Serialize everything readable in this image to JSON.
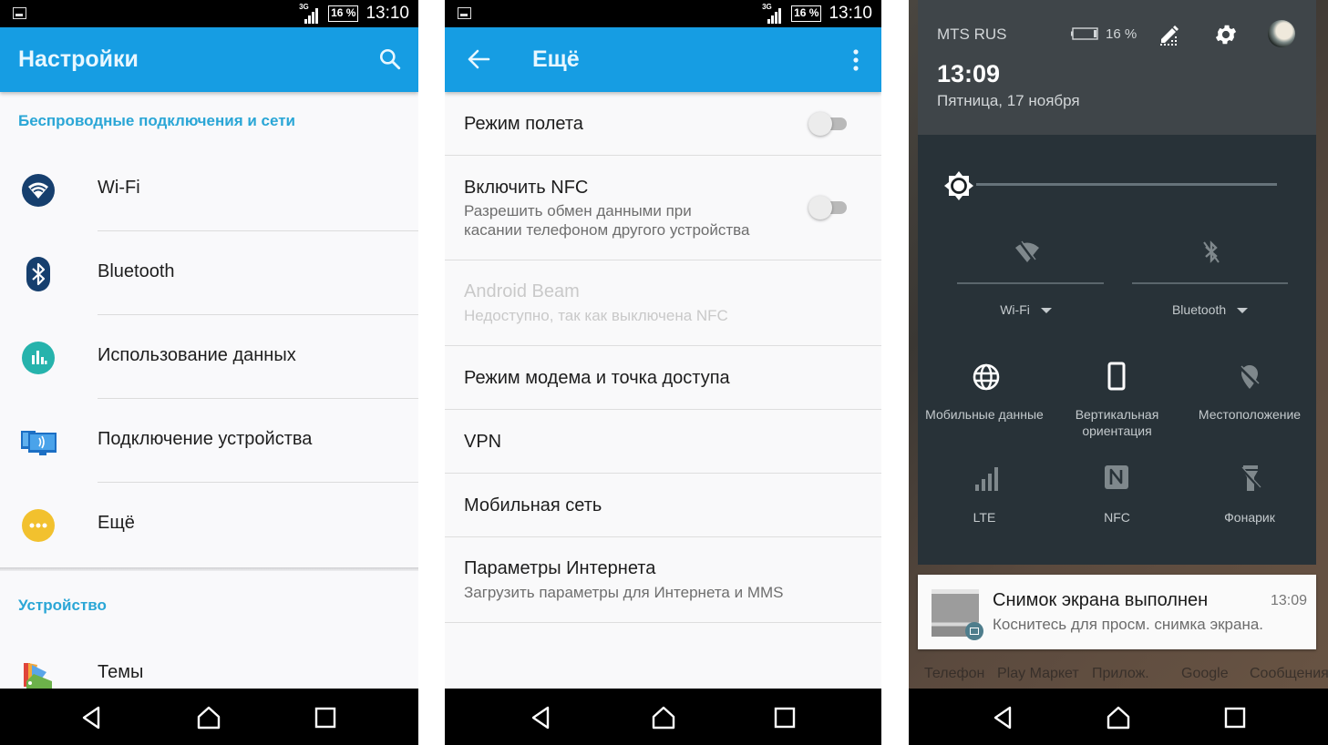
{
  "status_bar": {
    "network": "3G",
    "battery": "16 %",
    "time_p1": "13:10",
    "time_p2": "13:10"
  },
  "settings": {
    "title": "Настройки",
    "section_wireless": "Беспроводные подключения и сети",
    "items": [
      {
        "label": "Wi-Fi",
        "icon": "wifi-icon",
        "color": "#163f6e"
      },
      {
        "label": "Bluetooth",
        "icon": "bluetooth-icon",
        "color": "#163f6e"
      },
      {
        "label": "Использование данных",
        "icon": "data-usage-icon",
        "color": "#26b3ac"
      },
      {
        "label": "Подключение устройства",
        "icon": "device-connection-icon",
        "color": "#1c6fc4"
      },
      {
        "label": "Ещё",
        "icon": "more-icon",
        "color": "#f2c12e"
      }
    ],
    "section_device": "Устройство",
    "device_items": [
      {
        "label": "Темы",
        "icon": "themes-icon"
      }
    ]
  },
  "more": {
    "title": "Ещё",
    "items": [
      {
        "title": "Режим полета",
        "subtitle": "",
        "toggle": false,
        "enabled": true
      },
      {
        "title": "Включить NFC",
        "subtitle_line1": "Разрешить обмен данными при",
        "subtitle_line2": "касании телефоном другого устройства",
        "toggle": false,
        "enabled": true
      },
      {
        "title": "Android Beam",
        "subtitle": "Недоступно, так как выключена NFC",
        "enabled": false
      },
      {
        "title": "Режим модема и точка доступа",
        "enabled": true
      },
      {
        "title": "VPN",
        "enabled": true
      },
      {
        "title": "Мобильная сеть",
        "enabled": true
      },
      {
        "title": "Параметры Интернета",
        "subtitle": "Загрузить параметры для Интернета и MMS",
        "enabled": true
      }
    ]
  },
  "shade": {
    "carrier": "MTS RUS",
    "battery": "16 %",
    "time": "13:09",
    "date": "Пятница, 17 ноября",
    "brightness_level": 0.0,
    "tiles_top": [
      {
        "label": "Wi-Fi",
        "icon": "wifi-off-icon",
        "active": false
      },
      {
        "label": "Bluetooth",
        "icon": "bluetooth-off-icon",
        "active": false
      }
    ],
    "tiles": [
      {
        "label": "Мобильные данные",
        "icon": "globe-icon",
        "active": true
      },
      {
        "label_line1": "Вертикальная",
        "label_line2": "ориентация",
        "icon": "phone-portrait-icon",
        "active": true
      },
      {
        "label": "Местоположение",
        "icon": "location-off-icon",
        "active": false
      },
      {
        "label": "LTE",
        "icon": "signal-icon",
        "active": false
      },
      {
        "label": "NFC",
        "icon": "nfc-icon",
        "active": false
      },
      {
        "label": "Фонарик",
        "icon": "flashlight-off-icon",
        "active": false
      }
    ],
    "notification": {
      "title": "Снимок экрана выполнен",
      "text": "Коснитесь для просм. снимка экрана.",
      "time": "13:09"
    },
    "dock": [
      "Телефон",
      "Play Маркет",
      "Прилож.",
      "Google",
      "Сообщения"
    ]
  },
  "colors": {
    "appbar": "#169de3",
    "section_header": "#2aa6d6",
    "shade_header": "#3f4549",
    "shade_tiles": "#283238"
  }
}
